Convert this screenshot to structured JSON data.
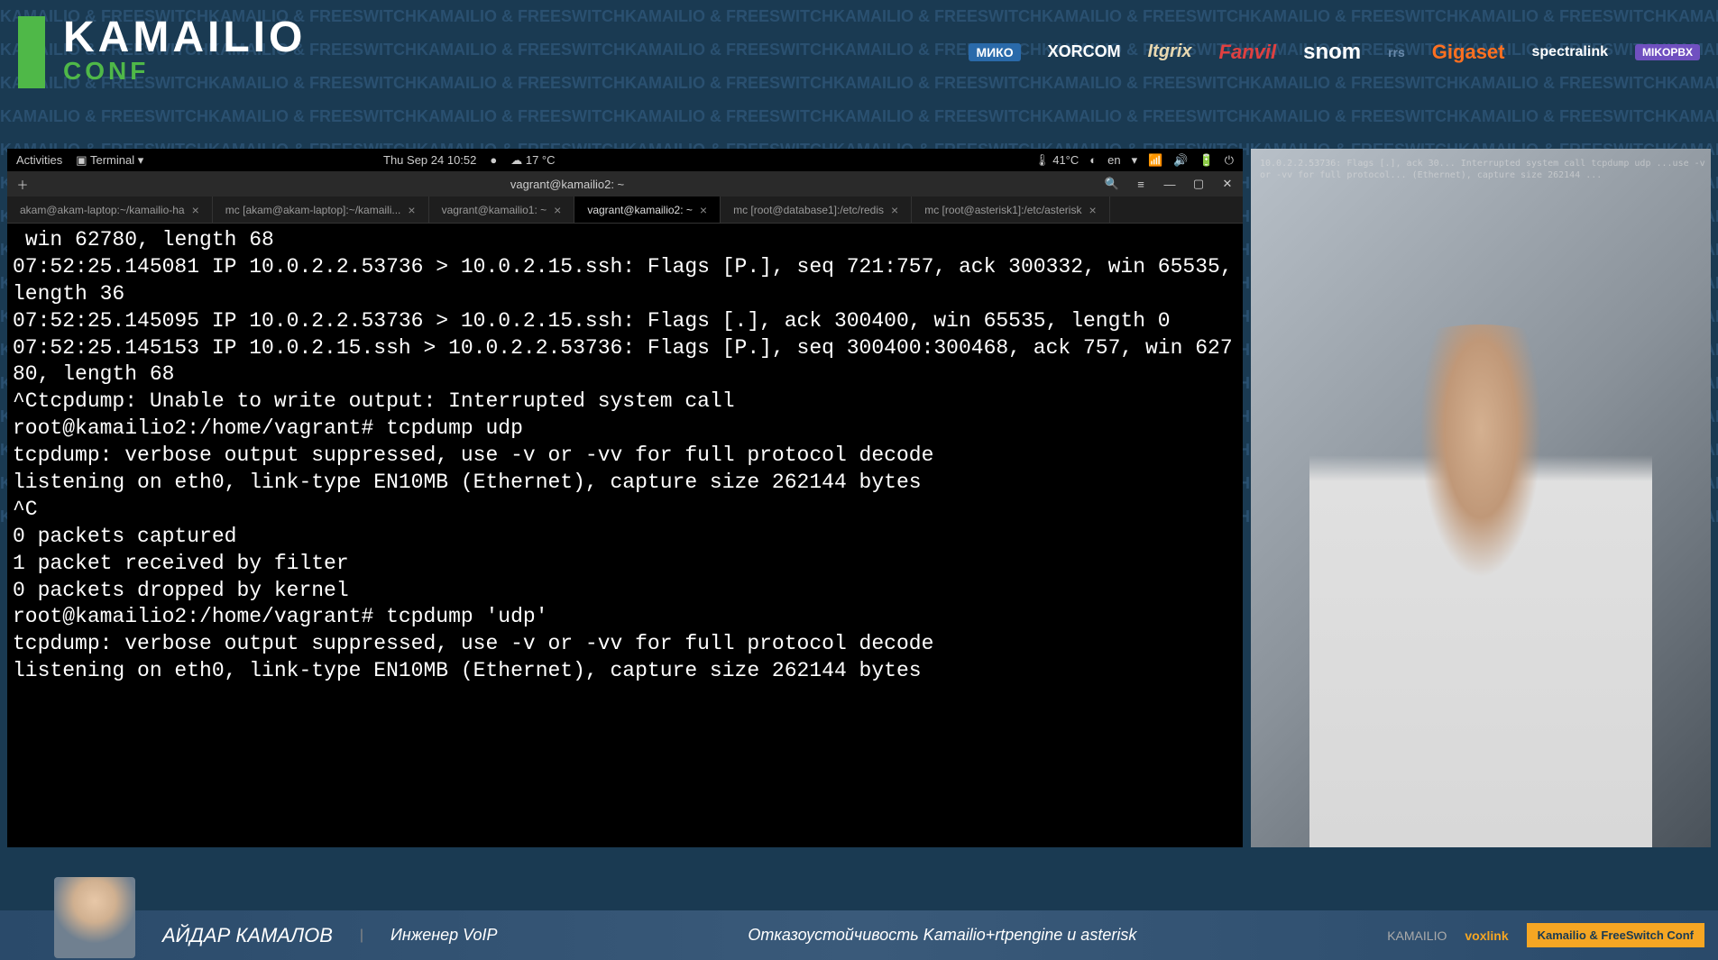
{
  "bgWatermark": "KAMAILIO & FREESWITCH",
  "header": {
    "logoMain": "KAMAILIO",
    "logoSub": "CONF",
    "sponsors": [
      "МИКО",
      "XORCOM",
      "Itgrix",
      "Fanvil",
      "snom",
      "rrs",
      "Gigaset",
      "spectralink",
      "MIKOPBX"
    ]
  },
  "gnome": {
    "activities": "Activities",
    "appTerminal": "Terminal",
    "datetime": "Thu Sep 24  10:52",
    "weather": "17 °C",
    "temp2": "41°C",
    "lang": "en"
  },
  "termWindow": {
    "title": "vagrant@kamailio2: ~",
    "newTabIcon": "＋",
    "searchIcon": "🔍",
    "menuIcon": "≡",
    "minIcon": "—",
    "maxIcon": "▢",
    "closeIcon": "✕"
  },
  "tabs": [
    {
      "label": "akam@akam-laptop:~/kamailio-ha",
      "active": false
    },
    {
      "label": "mc [akam@akam-laptop]:~/kamaili...",
      "active": false
    },
    {
      "label": "vagrant@kamailio1: ~",
      "active": false
    },
    {
      "label": "vagrant@kamailio2: ~",
      "active": true
    },
    {
      "label": "mc [root@database1]:/etc/redis",
      "active": false
    },
    {
      "label": "mc [root@asterisk1]:/etc/asterisk",
      "active": false
    }
  ],
  "terminalLines": [
    " win 62780, length 68",
    "07:52:25.145081 IP 10.0.2.2.53736 > 10.0.2.15.ssh: Flags [P.], seq 721:757, ack 300332, win 65535, length 36",
    "07:52:25.145095 IP 10.0.2.2.53736 > 10.0.2.15.ssh: Flags [.], ack 300400, win 65535, length 0",
    "07:52:25.145153 IP 10.0.2.15.ssh > 10.0.2.2.53736: Flags [P.], seq 300400:300468, ack 757, win 62780, length 68",
    "^Ctcpdump: Unable to write output: Interrupted system call",
    "root@kamailio2:/home/vagrant# tcpdump udp",
    "tcpdump: verbose output suppressed, use -v or -vv for full protocol decode",
    "listening on eth0, link-type EN10MB (Ethernet), capture size 262144 bytes",
    "^C",
    "0 packets captured",
    "1 packet received by filter",
    "0 packets dropped by kernel",
    "root@kamailio2:/home/vagrant# tcpdump 'udp'",
    "tcpdump: verbose output suppressed, use -v or -vv for full protocol decode",
    "listening on eth0, link-type EN10MB (Ethernet), capture size 262144 bytes"
  ],
  "webcamOverlay": [
    "10.0.2.2.53736: Flags [.], ack 30...",
    "Interrupted system call",
    "tcpdump udp",
    "...use -v or -vv for full protocol...",
    "(Ethernet), capture size 262144 ..."
  ],
  "footer": {
    "presenterName": "АЙДАР КАМАЛОВ",
    "presenterRole": "Инженер VoIP",
    "talkTitle": "Отказоустойчивость Kamailio+rtpengine и asterisk",
    "logo1": "KAMAILIO",
    "logo2": "voxlink",
    "badge": "Kamailio & FreeSwitch Conf"
  }
}
